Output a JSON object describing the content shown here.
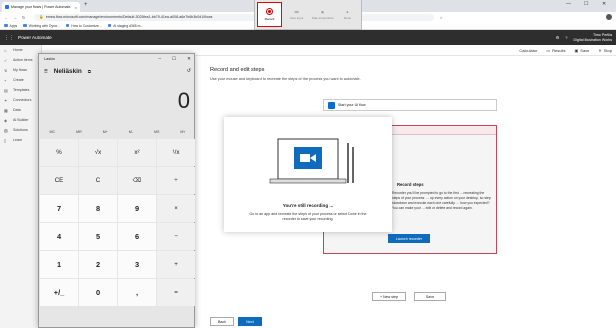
{
  "browser": {
    "tab_title": "Manage your flows | Power Automate",
    "url": "emea.flow.microsoft.com/manage/environments/Default-3025fea1-bb79-41ea-a008-a6e7b6b3b0d1/flows",
    "bookmarks": [
      "Apps",
      "Working with Dyna...",
      "How to Customize...",
      "AI staging d365.m..."
    ]
  },
  "recorder": {
    "record": "Record",
    "user_input": "User input",
    "take_screenshot": "Take screenshot",
    "done": "Done"
  },
  "app": {
    "name": "Power Automate",
    "user": "Timo Pertila",
    "org": "Digital Illustration Works",
    "commands": [
      "Calculator",
      "Results",
      "Save",
      "Stop"
    ]
  },
  "nav": [
    "Home",
    "Action items",
    "My flows",
    "Create",
    "Templates",
    "Connectors",
    "Data",
    "AI Builder",
    "Solutions",
    "Learn"
  ],
  "main": {
    "title": "Record and edit steps",
    "subtitle": "Use your mouse and keyboard to recreate the steps of the process you want to automate.",
    "start": "Start your UI flow",
    "new_step": "+ New step",
    "save": "Save",
    "back": "Back",
    "next": "Next"
  },
  "record_panel": {
    "title": "Record steps",
    "text": "Recorder you'll be prompted to go to the first ... recreating the steps of your process. ... up every action on your desktop, so step slowdown and execute each one carefully. ... how you expected? You can make your ... edit or delete and record again.",
    "launch": "Launch recorder"
  },
  "modal": {
    "title": "You're still recording ...",
    "text": "Go to an app and recreate the steps of your process or select Done in the recorder to save your recording."
  },
  "calculator": {
    "window_title": "Laskin",
    "mode": "Neliäskin",
    "display": "0",
    "memory": [
      "MC",
      "MR",
      "M+",
      "M-",
      "MS",
      "M˅"
    ],
    "keys": [
      "%",
      "√x",
      "x²",
      "¹/x",
      "CE",
      "C",
      "⌫",
      "÷",
      "7",
      "8",
      "9",
      "×",
      "4",
      "5",
      "6",
      "−",
      "1",
      "2",
      "3",
      "+",
      "+/_",
      "0",
      ",",
      "="
    ]
  }
}
